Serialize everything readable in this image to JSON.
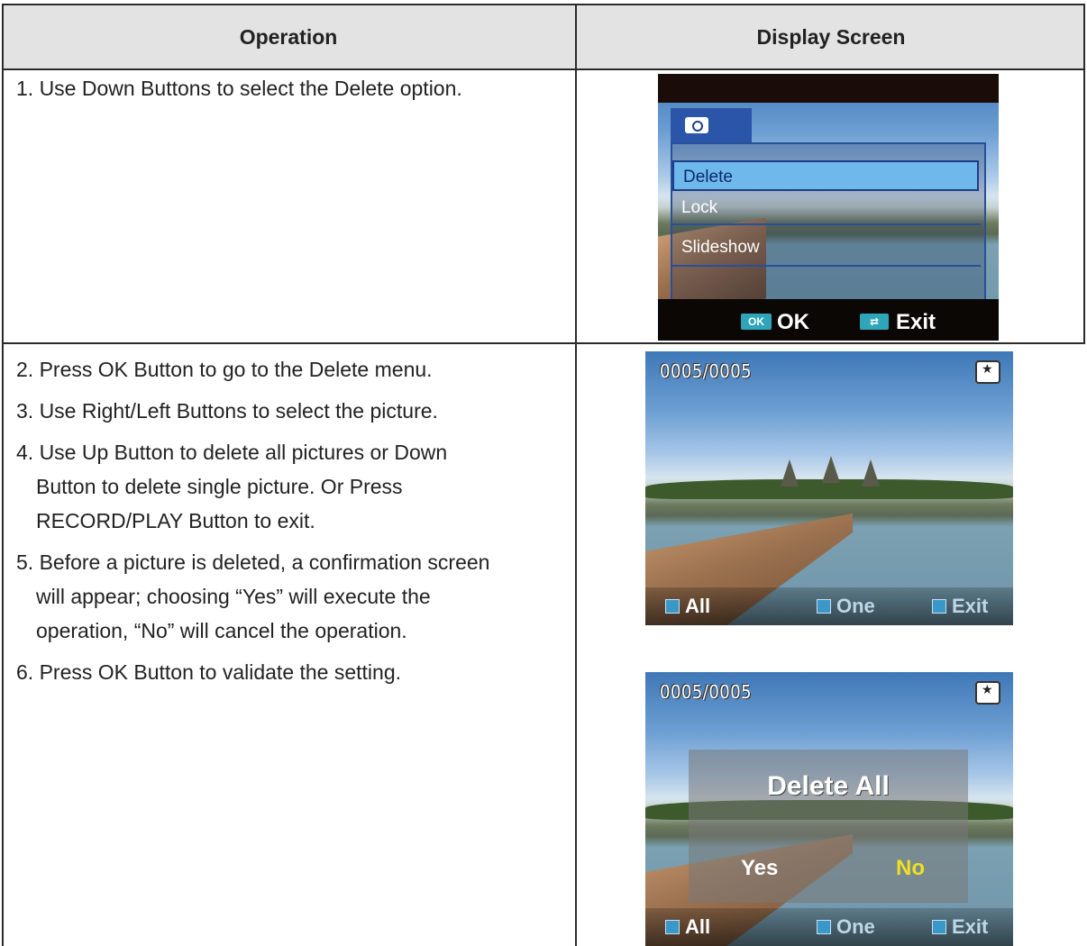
{
  "table": {
    "headers": {
      "operation": "Operation",
      "display": "Display Screen"
    },
    "row1": {
      "step1": "1. Use Down Buttons to select the Delete option."
    },
    "row2": {
      "steps": [
        "2. Press OK Button to go to the Delete menu.",
        "3. Use Right/Left Buttons to select the picture.",
        "4. Use Up Button to delete all pictures or Down",
        "Button to delete single picture. Or Press",
        "RECORD/PLAY Button to exit.",
        "5. Before a picture is deleted, a confirmation screen",
        "will appear; choosing “Yes” will execute the",
        "operation, “No” will cancel the operation.",
        "6. Press OK Button to validate the setting."
      ]
    }
  },
  "screen1": {
    "menu_items": [
      "Delete",
      "Lock",
      "Slideshow"
    ],
    "selected": "Delete",
    "ok_key": "OK",
    "ok_label": "OK",
    "exit_label": "Exit",
    "tab_icon": "camera-icon"
  },
  "screen2": {
    "counter": "0005/0005",
    "all_label": "All",
    "one_label": "One",
    "exit_label": "Exit"
  },
  "screen3": {
    "counter": "0005/0005",
    "dialog_title": "Delete All",
    "yes_label": "Yes",
    "no_label": "No",
    "all_label": "All",
    "one_label": "One",
    "exit_label": "Exit"
  }
}
